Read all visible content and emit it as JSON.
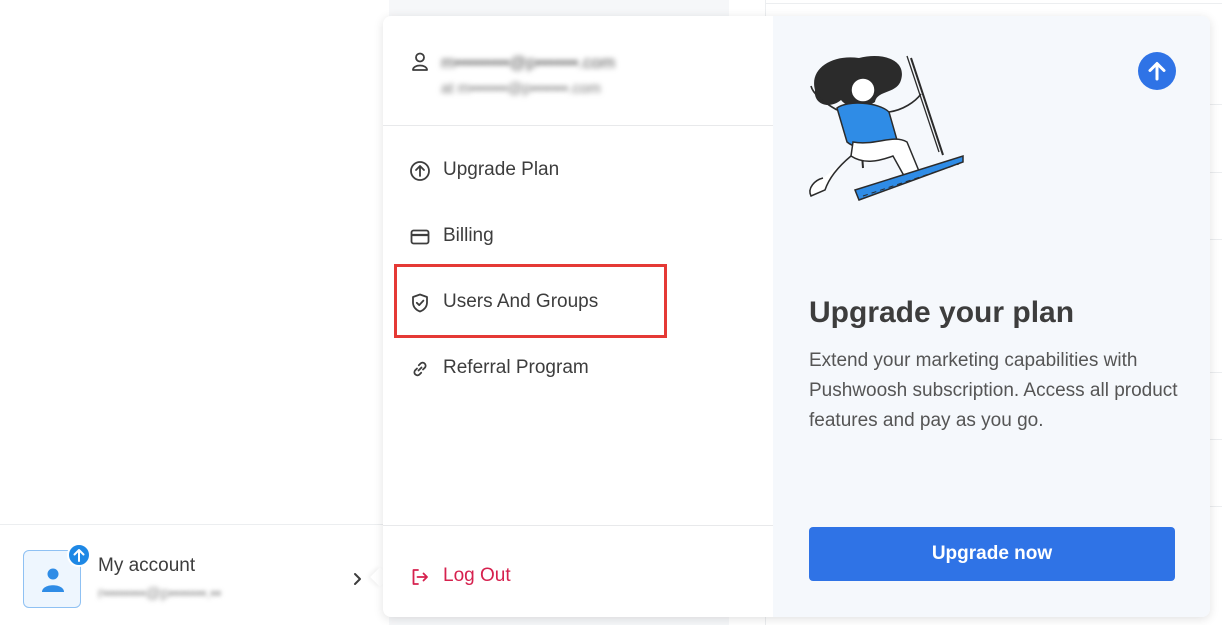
{
  "account": {
    "title": "My account",
    "email": "r▪▪▪▪▪▪▪▪@p▪▪▪▪▪▪▪.▪▪"
  },
  "popover": {
    "user": {
      "email": "m▪▪▪▪▪▪▪▪▪@p▪▪▪▪▪▪▪.com",
      "subline": "at m▪▪▪▪▪▪▪@p▪▪▪▪▪▪▪.com"
    },
    "menu": [
      {
        "label": "Upgrade Plan",
        "icon": "arrow-up-circle-icon"
      },
      {
        "label": "Billing",
        "icon": "credit-card-icon"
      },
      {
        "label": "Users And Groups",
        "icon": "shield-check-icon"
      },
      {
        "label": "Referral Program",
        "icon": "link-icon"
      }
    ],
    "logout_label": "Log Out"
  },
  "promo": {
    "title": "Upgrade your plan",
    "text": "Extend your marketing capabilities with Pushwoosh subscription. Access all product features and pay as you go.",
    "button": "Upgrade now"
  },
  "colors": {
    "accent": "#2f73e6",
    "logout": "#d6214e",
    "highlight": "#e53935",
    "promo_bg": "#f5f8fc"
  }
}
